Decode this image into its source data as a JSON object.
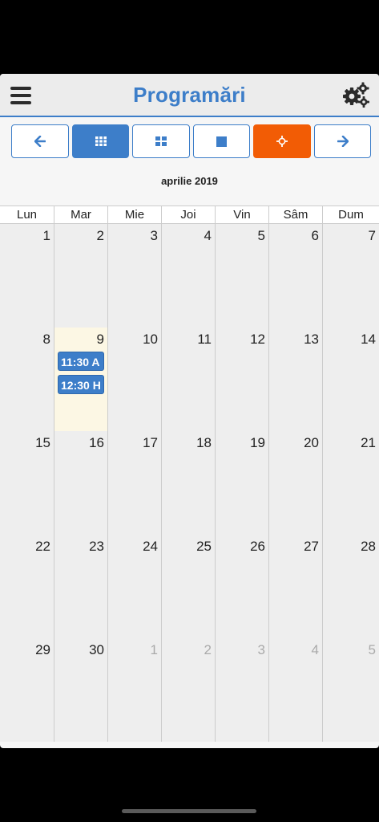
{
  "header": {
    "title": "Programări",
    "menu_icon": "hamburger-menu-icon",
    "settings_icon": "gears-icon"
  },
  "toolbar": {
    "buttons": [
      {
        "name": "prev-button",
        "icon": "arrow-left-icon"
      },
      {
        "name": "month-view-button",
        "icon": "grid-small-icon",
        "active": true
      },
      {
        "name": "week-view-button",
        "icon": "grid-large-icon"
      },
      {
        "name": "day-view-button",
        "icon": "square-icon"
      },
      {
        "name": "today-button",
        "icon": "crosshair-icon"
      },
      {
        "name": "next-button",
        "icon": "arrow-right-icon"
      }
    ]
  },
  "calendar": {
    "month_label": "aprilie 2019",
    "weekdays": [
      "Lun",
      "Mar",
      "Mie",
      "Joi",
      "Vin",
      "Sâm",
      "Dum"
    ],
    "weeks": [
      [
        {
          "n": "1"
        },
        {
          "n": "2"
        },
        {
          "n": "3"
        },
        {
          "n": "4"
        },
        {
          "n": "5"
        },
        {
          "n": "6"
        },
        {
          "n": "7"
        }
      ],
      [
        {
          "n": "8"
        },
        {
          "n": "9",
          "today": true,
          "events": [
            "11:30 A",
            "12:30 H"
          ]
        },
        {
          "n": "10"
        },
        {
          "n": "11"
        },
        {
          "n": "12"
        },
        {
          "n": "13"
        },
        {
          "n": "14"
        }
      ],
      [
        {
          "n": "15"
        },
        {
          "n": "16"
        },
        {
          "n": "17"
        },
        {
          "n": "18"
        },
        {
          "n": "19"
        },
        {
          "n": "20"
        },
        {
          "n": "21"
        }
      ],
      [
        {
          "n": "22"
        },
        {
          "n": "23"
        },
        {
          "n": "24"
        },
        {
          "n": "25"
        },
        {
          "n": "26"
        },
        {
          "n": "27"
        },
        {
          "n": "28"
        }
      ],
      [
        {
          "n": "29"
        },
        {
          "n": "30"
        },
        {
          "n": "1",
          "other": true
        },
        {
          "n": "2",
          "other": true
        },
        {
          "n": "3",
          "other": true
        },
        {
          "n": "4",
          "other": true
        },
        {
          "n": "5",
          "other": true
        }
      ]
    ]
  },
  "colors": {
    "accent": "#3d7ec9",
    "today_button": "#f25c05",
    "today_cell": "#fcf7e4"
  }
}
